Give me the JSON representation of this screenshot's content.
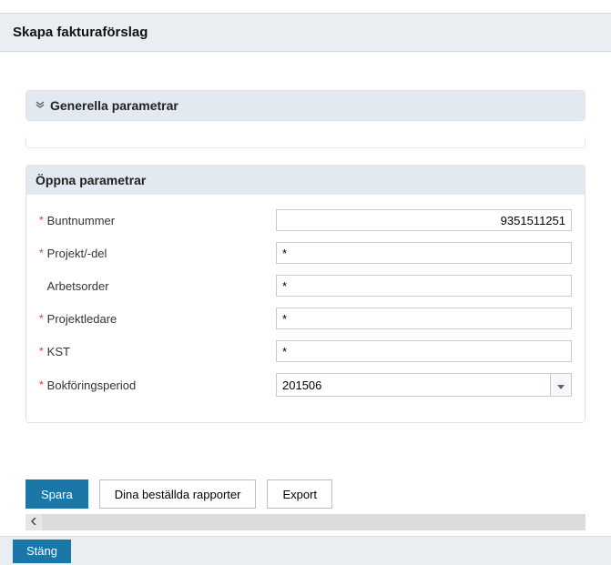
{
  "header": {
    "title": "Skapa fakturaförslag"
  },
  "panels": {
    "general": {
      "title": "Generella parametrar"
    },
    "open": {
      "title": "Öppna parametrar",
      "fields": {
        "buntnummer": {
          "label": "Buntnummer",
          "value": "9351511251",
          "required": true
        },
        "projekt": {
          "label": "Projekt/-del",
          "value": "*",
          "required": true
        },
        "arbetsorder": {
          "label": "Arbetsorder",
          "value": "*",
          "required": false
        },
        "projektledare": {
          "label": "Projektledare",
          "value": "*",
          "required": true
        },
        "kst": {
          "label": "KST",
          "value": "*",
          "required": true
        },
        "period": {
          "label": "Bokföringsperiod",
          "value": "201506",
          "required": true
        }
      }
    }
  },
  "buttons": {
    "save": "Spara",
    "reports": "Dina beställda rapporter",
    "export": "Export",
    "close": "Stäng"
  },
  "symbols": {
    "required": "*",
    "collapse": "≈"
  }
}
